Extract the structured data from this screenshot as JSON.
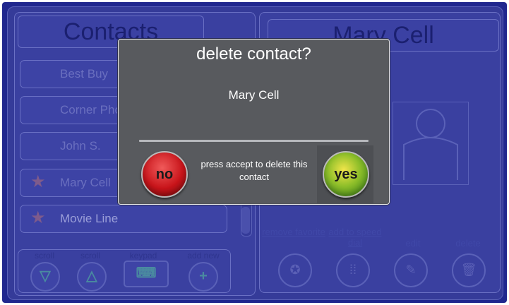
{
  "contacts_panel": {
    "title": "Contacts",
    "items": [
      {
        "label": "Best Buy",
        "favorite": false
      },
      {
        "label": "Corner Pho",
        "favorite": false
      },
      {
        "label": "John S.",
        "favorite": false
      },
      {
        "label": "Mary Cell",
        "favorite": true
      },
      {
        "label": "Movie Line",
        "favorite": true
      }
    ],
    "bottom_labels": [
      "scroll",
      "scroll",
      "keypad",
      "add new"
    ]
  },
  "detail_panel": {
    "title": "Mary Cell",
    "actions": [
      {
        "label": "remove favorite",
        "icon": "star-minus-icon"
      },
      {
        "label": "add to speed dial",
        "icon": "keypad-icon"
      },
      {
        "label": "edit",
        "icon": "edit-icon"
      },
      {
        "label": "delete",
        "icon": "trash-icon"
      }
    ]
  },
  "dialog": {
    "title": "delete contact?",
    "contact_name": "Mary Cell",
    "message": "press accept to delete this contact",
    "no_label": "no",
    "yes_label": "yes"
  },
  "colors": {
    "background": "#20278e",
    "dialog": "#585a5e",
    "no_button": "#c8141a",
    "yes_button": "#8fbf2a"
  }
}
